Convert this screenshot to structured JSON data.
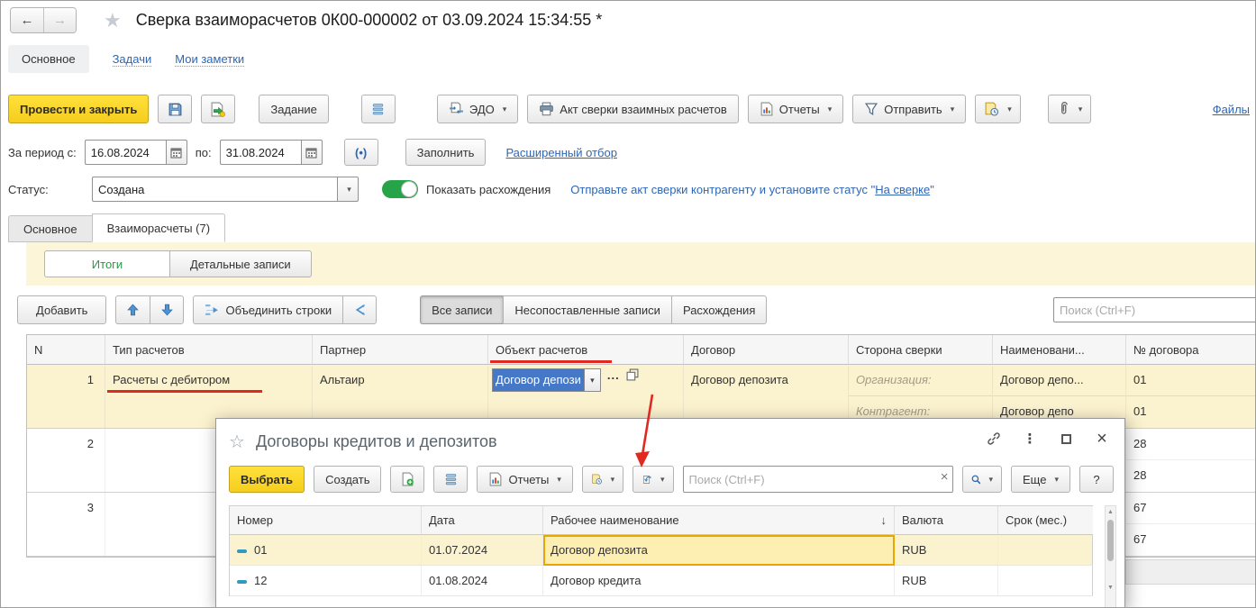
{
  "colors": {
    "accent_yellow": "#f6cd1d",
    "toggle_green": "#27a449",
    "link_blue": "#2e66b5",
    "annotation_red": "#e02a21",
    "selection_blue": "#4678c8",
    "row_highlight": "#fbf2cf"
  },
  "ui": {
    "back": "←",
    "forward": "→",
    "star": "★",
    "popup_star": "☆",
    "caret": "▾",
    "sort_desc": "↓",
    "kebab": "⋮",
    "close": "×",
    "clear": "×",
    "ellipsis": "...",
    "up_scroll": "▲",
    "down_scroll": "▼",
    "period_icon": "(•)",
    "help": "?"
  },
  "header": {
    "title": "Сверка взаиморасчетов 0К00-000002 от 03.09.2024 15:34:55 *"
  },
  "nav_tabs": {
    "main": "Основное",
    "tasks": "Задачи",
    "notes": "Мои заметки"
  },
  "toolbar": {
    "post_and_close": "Провести и закрыть",
    "task": "Задание",
    "edo": "ЭДО",
    "act": "Акт сверки взаимных расчетов",
    "reports": "Отчеты",
    "send": "Отправить",
    "files": "Файлы"
  },
  "period": {
    "label": "За период с:",
    "from": "16.08.2024",
    "to_label": "по:",
    "to": "31.08.2024",
    "fill": "Заполнить",
    "advanced": "Расширенный отбор"
  },
  "status": {
    "label": "Статус:",
    "value": "Создана",
    "show_diff": "Показать расхождения",
    "hint_prefix": "Отправьте акт сверки контрагенту и установите статус \"",
    "hint_link": "На сверке",
    "hint_suffix": "\""
  },
  "doc_tabs": {
    "main": "Основное",
    "settlements": "Взаиморасчеты (7)"
  },
  "view_switch": {
    "totals": "Итоги",
    "details": "Детальные записи"
  },
  "grid_toolbar": {
    "add": "Добавить",
    "merge": "Объединить строки",
    "filter_all": "Все записи",
    "filter_unmatched": "Несопоставленные записи",
    "filter_diff": "Расхождения",
    "search_placeholder": "Поиск (Ctrl+F)"
  },
  "grid": {
    "columns": {
      "n": "N",
      "type": "Тип расчетов",
      "partner": "Партнер",
      "object": "Объект расчетов",
      "contract": "Договор",
      "side": "Сторона сверки",
      "name": "Наименовани...",
      "number": "№ договора"
    },
    "row1": {
      "n": "1",
      "type": "Расчеты с дебитором",
      "partner": "Альтаир",
      "object_edit": "Договор депози",
      "contract": "Договор депозита",
      "side_org": "Организация:",
      "side_contr": "Контрагент:",
      "name1": "Договор депо...",
      "name2": "Договор депо",
      "num1": "01",
      "num2": "01"
    },
    "row2": {
      "n": "2",
      "num1": "28",
      "num2": "28"
    },
    "row3": {
      "n": "3",
      "num1": "67",
      "num2": "67"
    }
  },
  "popup": {
    "title": "Договоры кредитов и депозитов",
    "select": "Выбрать",
    "create": "Создать",
    "reports": "Отчеты",
    "more": "Еще",
    "help": "?",
    "search_placeholder": "Поиск (Ctrl+F)",
    "columns": {
      "number": "Номер",
      "date": "Дата",
      "name": "Рабочее наименование",
      "currency": "Валюта",
      "term": "Срок (мес.)"
    },
    "rows": [
      {
        "number": "01",
        "date": "01.07.2024",
        "name": "Договор депозита",
        "currency": "RUB",
        "term": ""
      },
      {
        "number": "12",
        "date": "01.08.2024",
        "name": "Договор кредита",
        "currency": "RUB",
        "term": ""
      }
    ]
  }
}
